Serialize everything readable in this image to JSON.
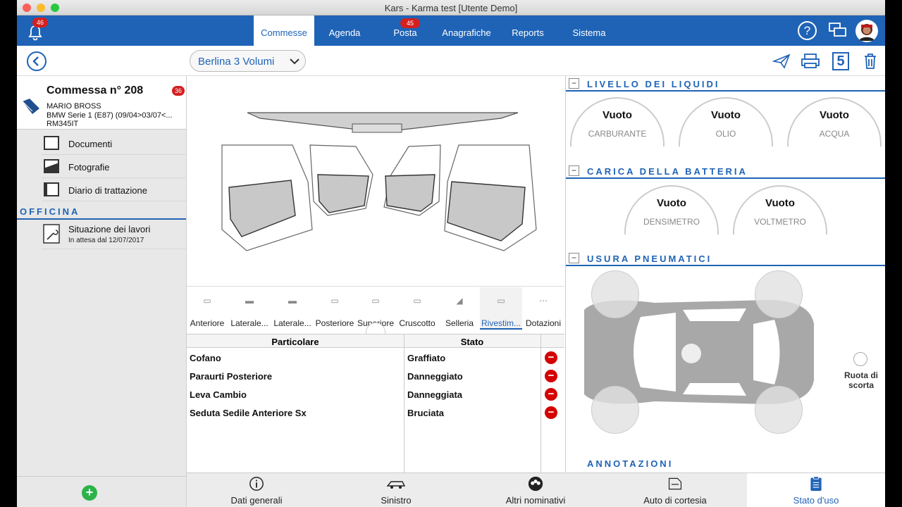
{
  "window": {
    "title": "Kars - Karma test [Utente Demo]"
  },
  "topnav": {
    "notifications_count": "46",
    "tabs": [
      {
        "label": "Commesse",
        "active": true
      },
      {
        "label": "Agenda"
      },
      {
        "label": "Posta",
        "badge": "45"
      },
      {
        "label": "Anagrafiche"
      },
      {
        "label": "Reports"
      },
      {
        "label": "Sistema"
      }
    ],
    "help_icon": "?"
  },
  "toolbar": {
    "vehicle_type": "Berlina 3 Volumi",
    "page_number": "5"
  },
  "sidebar": {
    "order_title": "Commessa n° 208",
    "order_badge": "36",
    "customer": "MARIO BROSS",
    "vehicle": "BMW Serie 1 (E87) (09/04>03/07<...",
    "plate": "RM345IT",
    "items": [
      {
        "label": "Documenti",
        "icon": "document-icon"
      },
      {
        "label": "Fotografie",
        "icon": "photo-icon"
      },
      {
        "label": "Diario di trattazione",
        "icon": "journal-icon"
      }
    ],
    "section_officina": "OFFICINA",
    "work_status_title": "Situazione dei lavori",
    "work_status_sub": "In attesa dal 12/07/2017",
    "add_symbol": "+"
  },
  "categories": [
    {
      "label": "Anteriore"
    },
    {
      "label": "Laterale..."
    },
    {
      "label": "Laterale..."
    },
    {
      "label": "Posteriore"
    },
    {
      "label": "Superiore"
    },
    {
      "label": "Cruscotto"
    },
    {
      "label": "Selleria"
    },
    {
      "label": "Rivestim...",
      "active": true
    },
    {
      "label": "Dotazioni"
    }
  ],
  "damage_table": {
    "headers": [
      "Particolare",
      "Stato"
    ],
    "rows": [
      {
        "part": "Cofano",
        "state": "Graffiato"
      },
      {
        "part": "Paraurti Posteriore",
        "state": "Danneggiato"
      },
      {
        "part": "Leva Cambio",
        "state": "Danneggiata"
      },
      {
        "part": "Seduta Sedile Anteriore Sx",
        "state": "Bruciata"
      }
    ],
    "remove_symbol": "−"
  },
  "right_panel": {
    "liquids_title": "LIVELLO DEI LIQUIDI",
    "liquids": [
      {
        "value": "Vuoto",
        "label": "CARBURANTE"
      },
      {
        "value": "Vuoto",
        "label": "OLIO"
      },
      {
        "value": "Vuoto",
        "label": "ACQUA"
      }
    ],
    "battery_title": "CARICA DELLA BATTERIA",
    "battery": [
      {
        "value": "Vuoto",
        "label": "DENSIMETRO"
      },
      {
        "value": "Vuoto",
        "label": "VOLTMETRO"
      }
    ],
    "tires_title": "USURA PNEUMATICI",
    "spare_tire_label": "Ruota di scorta",
    "notes_title": "ANNOTAZIONI",
    "collapse_symbol": "−"
  },
  "bottom_tabs": [
    {
      "label": "Dati generali",
      "icon": "info-icon"
    },
    {
      "label": "Sinistro",
      "icon": "car-crash-icon"
    },
    {
      "label": "Altri nominativi",
      "icon": "people-icon"
    },
    {
      "label": "Auto di cortesia",
      "icon": "courtesy-car-icon"
    },
    {
      "label": "Stato d'uso",
      "icon": "clipboard-icon",
      "active": true
    }
  ],
  "colors": {
    "accent": "#1f63b6",
    "danger": "#d40000"
  }
}
